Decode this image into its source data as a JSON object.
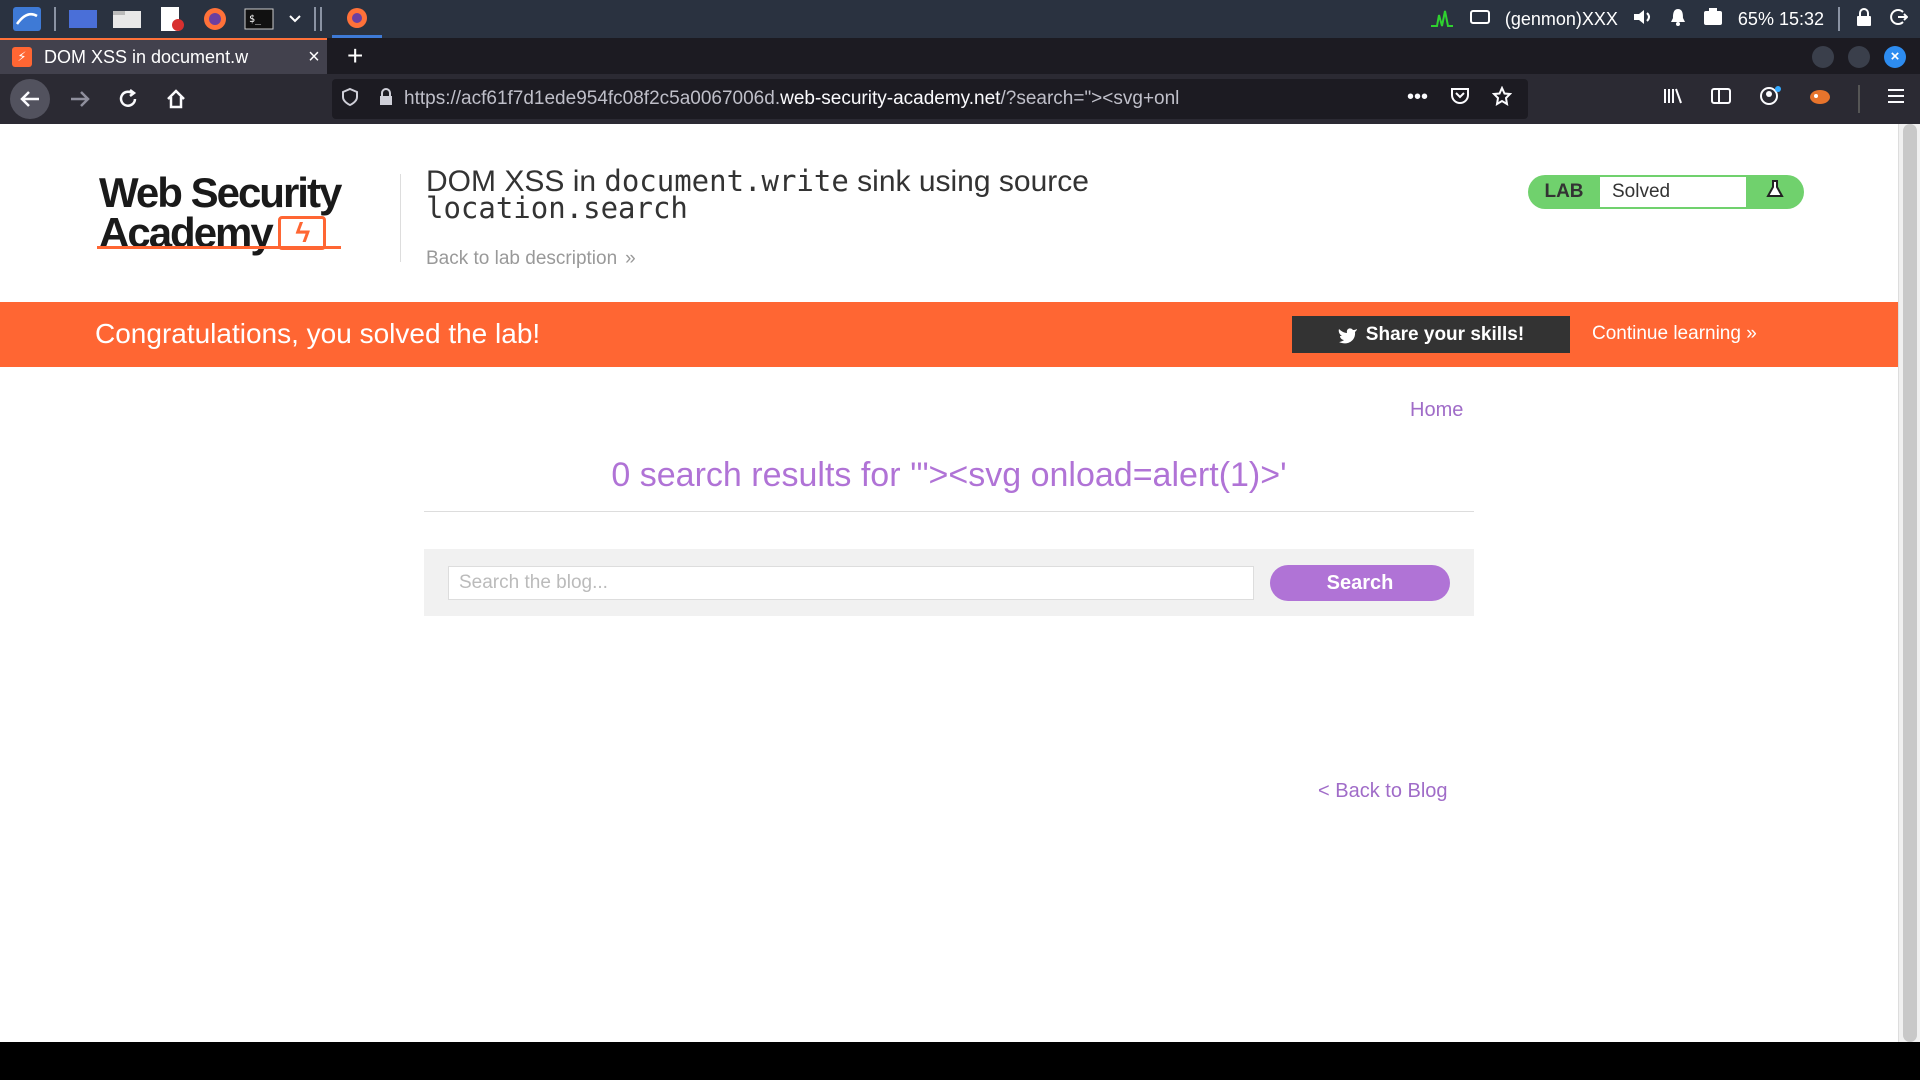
{
  "taskbar": {
    "status_text": "(genmon)XXX",
    "battery_time": "65% 15:32"
  },
  "browser": {
    "tab_title": "DOM XSS in document.w",
    "tab_close": "×",
    "new_tab": "+",
    "url_dim": "https://acf61f7d1ede954fc08f2c5a0067006d.",
    "url_host": "web-security-academy.net",
    "url_path": "/?search=\"><svg+onl",
    "url_more": "•••"
  },
  "page": {
    "logo_line1": "Web Security",
    "logo_line2": "Academy",
    "lab_title_part1": "DOM XSS in ",
    "lab_title_code1": "document.write",
    "lab_title_part2": " sink using source",
    "lab_title_code2": "location.search",
    "back_to_description": "Back to lab description",
    "back_chevron": "»",
    "lab_label": "LAB",
    "lab_status": "Solved",
    "congrats": "Congratulations, you solved the lab!",
    "share_button": "Share your skills!",
    "continue_learning": "Continue learning »",
    "home_link": "Home",
    "results_heading": "0 search results for '\"><svg onload=alert(1)>'",
    "search_placeholder": "Search the blog...",
    "search_button": "Search",
    "back_to_blog": "< Back to Blog"
  },
  "colors": {
    "brand_orange": "#ff6633",
    "lab_green": "#70d16d",
    "link_purple": "#a06cc8",
    "button_purple": "#b073d6"
  }
}
